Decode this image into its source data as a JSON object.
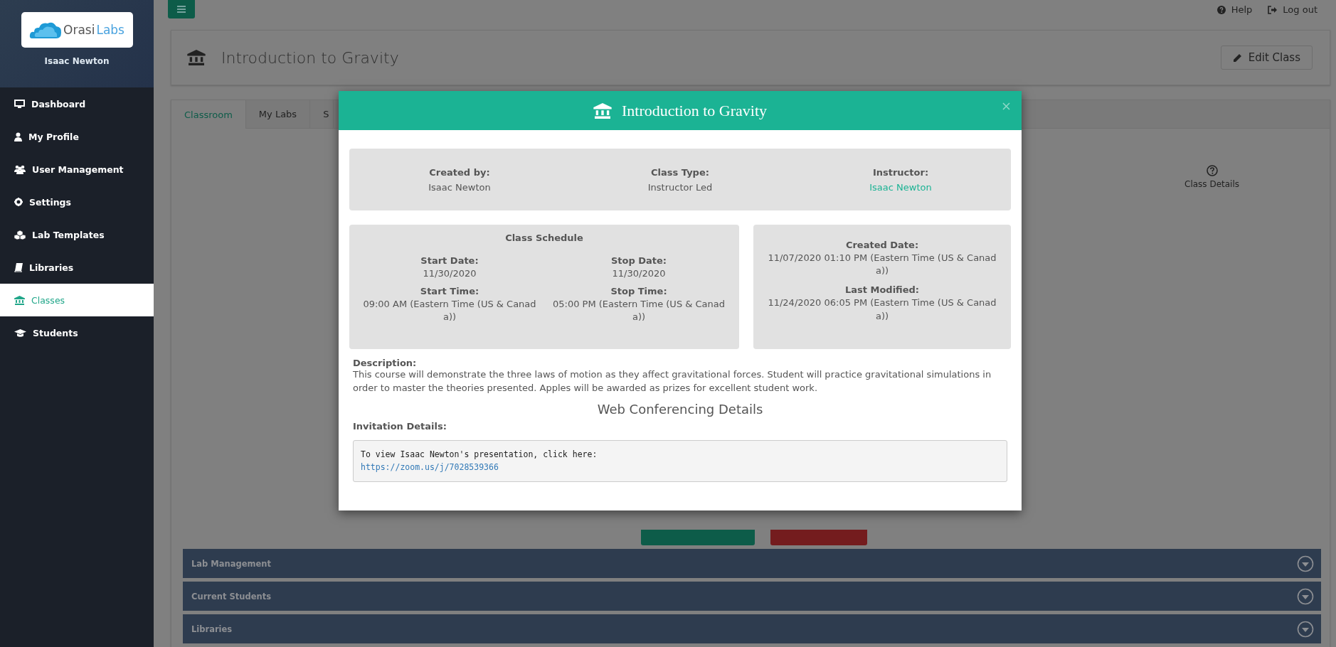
{
  "sidebar": {
    "logo": {
      "text_1": "Orasi",
      "text_2": "Labs"
    },
    "user": "Isaac Newton",
    "items": [
      {
        "label": "Dashboard",
        "kind": "monitor",
        "selected": false
      },
      {
        "label": "My Profile",
        "kind": "user",
        "selected": false
      },
      {
        "label": "User Management",
        "kind": "users",
        "selected": false
      },
      {
        "label": "Settings",
        "kind": "gear",
        "selected": false
      },
      {
        "label": "Lab Templates",
        "kind": "cubes",
        "selected": false
      },
      {
        "label": "Libraries",
        "kind": "book",
        "selected": false
      },
      {
        "label": "Classes",
        "kind": "bank",
        "selected": true
      },
      {
        "label": "Students",
        "kind": "cap",
        "selected": false
      }
    ]
  },
  "topbar": {
    "links": [
      {
        "label": "Help",
        "kind": "help"
      },
      {
        "label": "Log out",
        "kind": "logout"
      }
    ]
  },
  "page_header": {
    "title": "Introduction to Gravity",
    "edit_button": "Edit Class"
  },
  "tabs": [
    {
      "label": "Classroom",
      "selected": true
    },
    {
      "label": "My Labs",
      "selected": false
    },
    {
      "label": "S",
      "selected": false
    }
  ],
  "class_details_link": "Class Details",
  "accordions": [
    {
      "title": "Lab Management"
    },
    {
      "title": "Current Students"
    },
    {
      "title": "Libraries"
    }
  ],
  "modal": {
    "title": "Introduction to Gravity",
    "summary": [
      {
        "label": "Created by:",
        "value": "Isaac Newton",
        "kind": "text"
      },
      {
        "label": "Class Type:",
        "value": "Instructor Led",
        "kind": "text"
      },
      {
        "label": "Instructor:",
        "value": "Isaac Newton",
        "kind": "link"
      }
    ],
    "schedule": {
      "title": "Class Schedule",
      "fields": [
        {
          "label": "Start Date:",
          "value": "11/30/2020"
        },
        {
          "label": "Stop Date:",
          "value": "11/30/2020"
        },
        {
          "label": "Start Time:",
          "value": "09:00 AM (Eastern Time (US & Canada))"
        },
        {
          "label": "Stop Time:",
          "value": "05:00 PM (Eastern Time (US & Canada))"
        }
      ]
    },
    "dates": [
      {
        "label": "Created Date:",
        "value": "11/07/2020 01:10 PM (Eastern Time (US & Canada))"
      },
      {
        "label": "Last Modified:",
        "value": "11/24/2020 06:05 PM (Eastern Time (US & Canada))"
      }
    ],
    "description": {
      "label": "Description:",
      "text": "This course will demonstrate the three laws of motion as they affect gravitational forces. Student will practice gravitational simulations in order to master the theories presented. Apples will be awarded as prizes for excellent student work."
    },
    "conferencing_title": "Web Conferencing Details",
    "invitation": {
      "label": "Invitation Details:",
      "text": "To view Isaac Newton's presentation, click here:",
      "link": "https://zoom.us/j/7028539366"
    }
  }
}
